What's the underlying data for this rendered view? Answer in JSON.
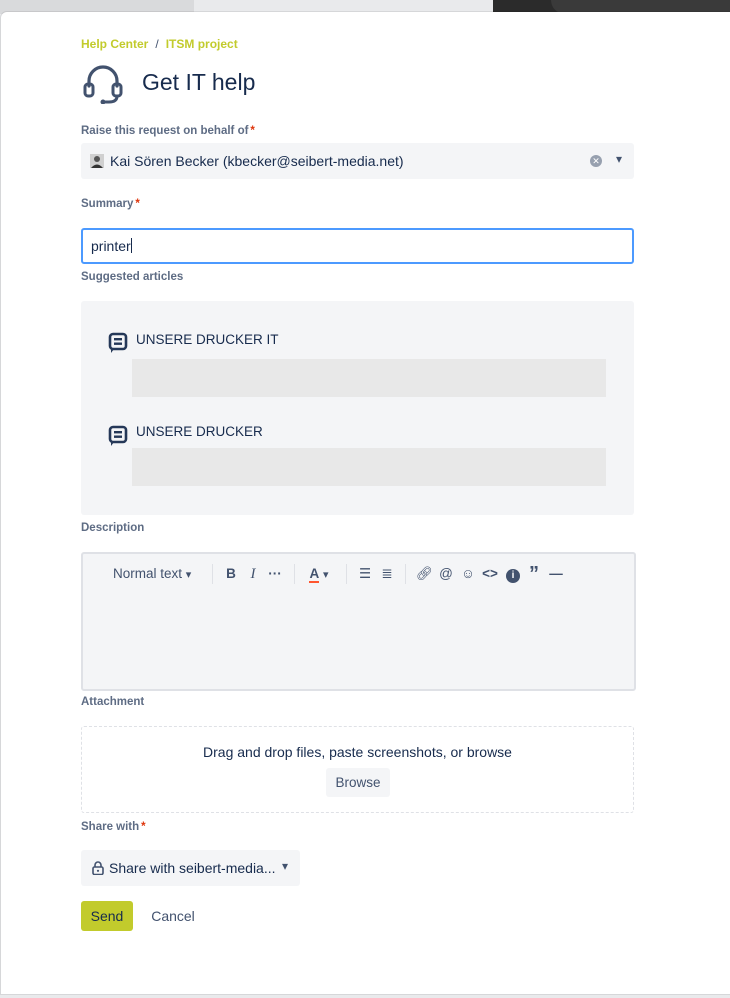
{
  "breadcrumbs": {
    "home": "Help Center",
    "separator": "/",
    "project": "ITSM project"
  },
  "page": {
    "title": "Get IT help",
    "icon": "headset-icon"
  },
  "on_behalf": {
    "label": "Raise this request on behalf of",
    "required_mark": "*",
    "value": "Kai Sören Becker (kbecker@seibert-media.net)"
  },
  "summary": {
    "label": "Summary",
    "required_mark": "*",
    "value": "printer"
  },
  "suggested": {
    "label": "Suggested articles",
    "items": [
      {
        "title": "UNSERE DRUCKER IT",
        "icon": "article-icon"
      },
      {
        "title": "UNSERE DRUCKER",
        "icon": "article-icon"
      }
    ]
  },
  "description": {
    "label": "Description",
    "toolbar": {
      "text_style": "Normal text",
      "tools": [
        "bold-icon",
        "italic-icon",
        "more-icon",
        "text-color-icon",
        "bullet-list-icon",
        "numbered-list-icon",
        "link-icon",
        "mention-icon",
        "emoji-icon",
        "code-icon",
        "info-icon",
        "quote-icon",
        "divider-icon"
      ]
    }
  },
  "attachment": {
    "label": "Attachment",
    "hint": "Drag and drop files, paste screenshots, or browse",
    "browse_label": "Browse"
  },
  "share": {
    "label": "Share with",
    "required_mark": "*",
    "value": "Share with seibert-media..."
  },
  "actions": {
    "send_label": "Send",
    "cancel_label": "Cancel"
  },
  "colors": {
    "accent": "#c2cb2c",
    "focus": "#4c9aff",
    "required": "#de350b",
    "text": "#172b4d",
    "muted": "#5e6c84"
  }
}
